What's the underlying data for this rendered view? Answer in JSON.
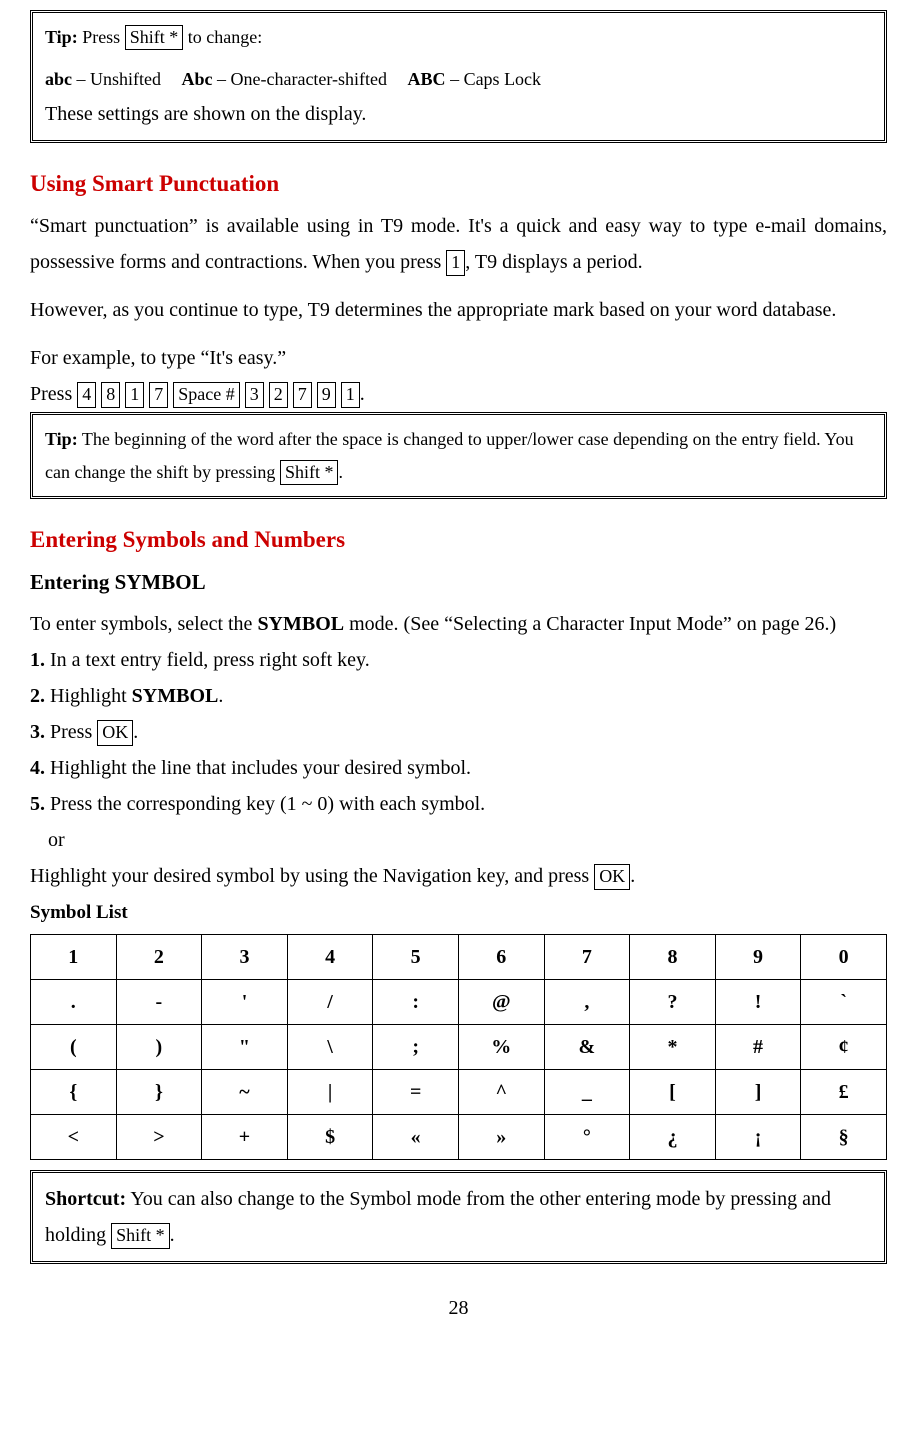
{
  "tipBox1": {
    "label": "Tip:",
    "press": " Press ",
    "key": "Shift *",
    "toChange": " to change:",
    "modes": {
      "m1b": "abc",
      "m1t": " – Unshifted",
      "m2b": "Abc",
      "m2t": " – One-character-shifted",
      "m3b": "ABC",
      "m3t": " – Caps Lock"
    },
    "footer": "These settings are shown on the display."
  },
  "sec1": {
    "heading": "Using Smart Punctuation",
    "p1a": "“Smart punctuation” is available using in T9 mode. It's a quick and easy way to type e-mail domains, possessive forms and contractions. When you press ",
    "key1": " 1 ",
    "p1b": ", T9 displays a period.",
    "p2": "However, as you continue to type, T9 determines the appropriate mark based on your word database.",
    "p3": "For example, to type “It's easy.”",
    "p4pre": "Press ",
    "keys": [
      " 4 ",
      " 8 ",
      " 1 ",
      " 7 ",
      "Space #",
      " 3 ",
      " 2 ",
      " 7 ",
      " 9 ",
      " 1 "
    ],
    "p4post": "."
  },
  "tipBox2": {
    "label": "Tip:",
    "text1": " The beginning of the word after the space is changed to upper/lower case depending on the entry field. You can change the shift by pressing ",
    "key": "Shift *",
    "text2": "."
  },
  "sec2": {
    "heading": "Entering Symbols and Numbers",
    "sub": "Entering SYMBOL",
    "p1a": "To enter symbols, select the ",
    "p1bold": "SYMBOL",
    "p1b": " mode. (See “Selecting a Character Input Mode” on page 26.)",
    "s1": {
      "n": "1.",
      "t": " In a text entry field, press right soft key."
    },
    "s2": {
      "n": "2.",
      "ta": " Highlight ",
      "bold": "SYMBOL",
      "tb": "."
    },
    "s3": {
      "n": "3.",
      "ta": " Press ",
      "key": "OK",
      "tb": "."
    },
    "s4": {
      "n": "4.",
      "t": " Highlight the line that includes your desired symbol."
    },
    "s5": {
      "n": "5.",
      "t": " Press the corresponding key (1 ~ 0) with each symbol."
    },
    "or": "or",
    "s6a": "  Highlight your desired symbol by using the Navigation key, and press ",
    "s6key": " OK ",
    "s6b": ".",
    "listLabel": "Symbol List"
  },
  "symbols": [
    [
      "1",
      "2",
      "3",
      "4",
      "5",
      "6",
      "7",
      "8",
      "9",
      "0"
    ],
    [
      ".",
      "-",
      "'",
      "/",
      ":",
      "@",
      ",",
      "?",
      "!",
      "`"
    ],
    [
      "(",
      ")",
      "\"",
      "\\",
      ";",
      "%",
      "&",
      "*",
      "#",
      "¢"
    ],
    [
      "{",
      "}",
      "~",
      "|",
      "=",
      "^",
      "_",
      "[",
      "]",
      "£"
    ],
    [
      "<",
      ">",
      "+",
      "$",
      "«",
      "»",
      "°",
      "¿",
      "¡",
      "§"
    ]
  ],
  "shortcut": {
    "label": "Shortcut:",
    "t1": " You can also change to the Symbol mode from the other entering mode by pressing and holding ",
    "key": "Shift *",
    "t2": "."
  },
  "pageNum": "28"
}
